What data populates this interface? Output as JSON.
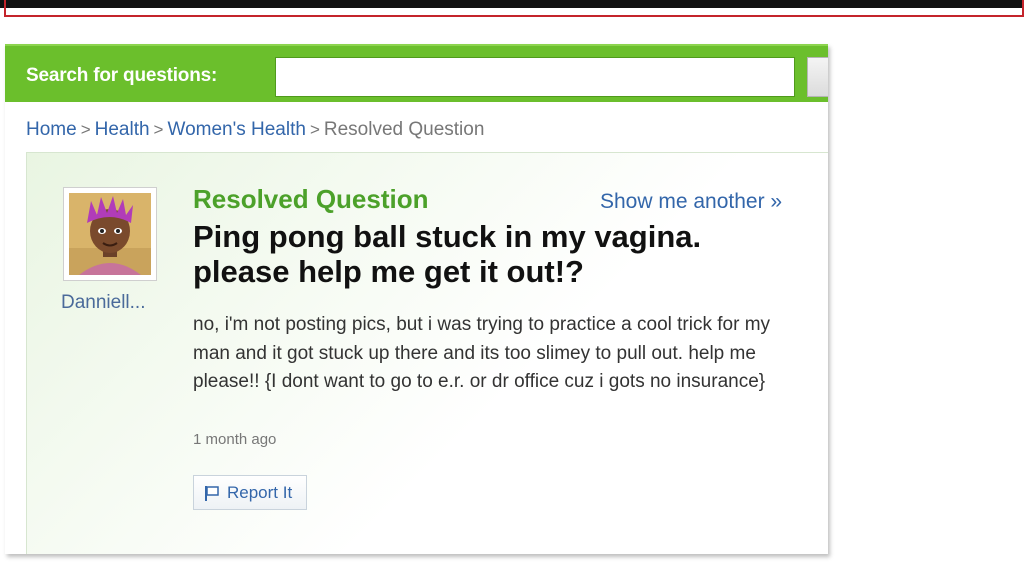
{
  "search": {
    "label": "Search for questions:",
    "value": "",
    "placeholder": ""
  },
  "breadcrumb": {
    "items": [
      "Home",
      "Health",
      "Women's Health"
    ],
    "current": "Resolved Question",
    "separator": ">"
  },
  "question": {
    "status": "Resolved Question",
    "show_another": "Show me another »",
    "title": "Ping pong ball stuck in my vagina. please help me get it out!?",
    "body": "no, i'm not posting pics, but i was trying to practice a cool trick for my man and it got stuck up there and its too slimey to pull out. help me please!! {I dont want to go to e.r. or dr office cuz i gots no insurance}",
    "timestamp": "1 month ago",
    "report_label": "Report It"
  },
  "user": {
    "name": "Danniell...",
    "avatar_icon": "cartoon-avatar"
  },
  "colors": {
    "brand_green": "#6bbf2c",
    "link_blue": "#3366aa",
    "status_green": "#4ca12a"
  }
}
